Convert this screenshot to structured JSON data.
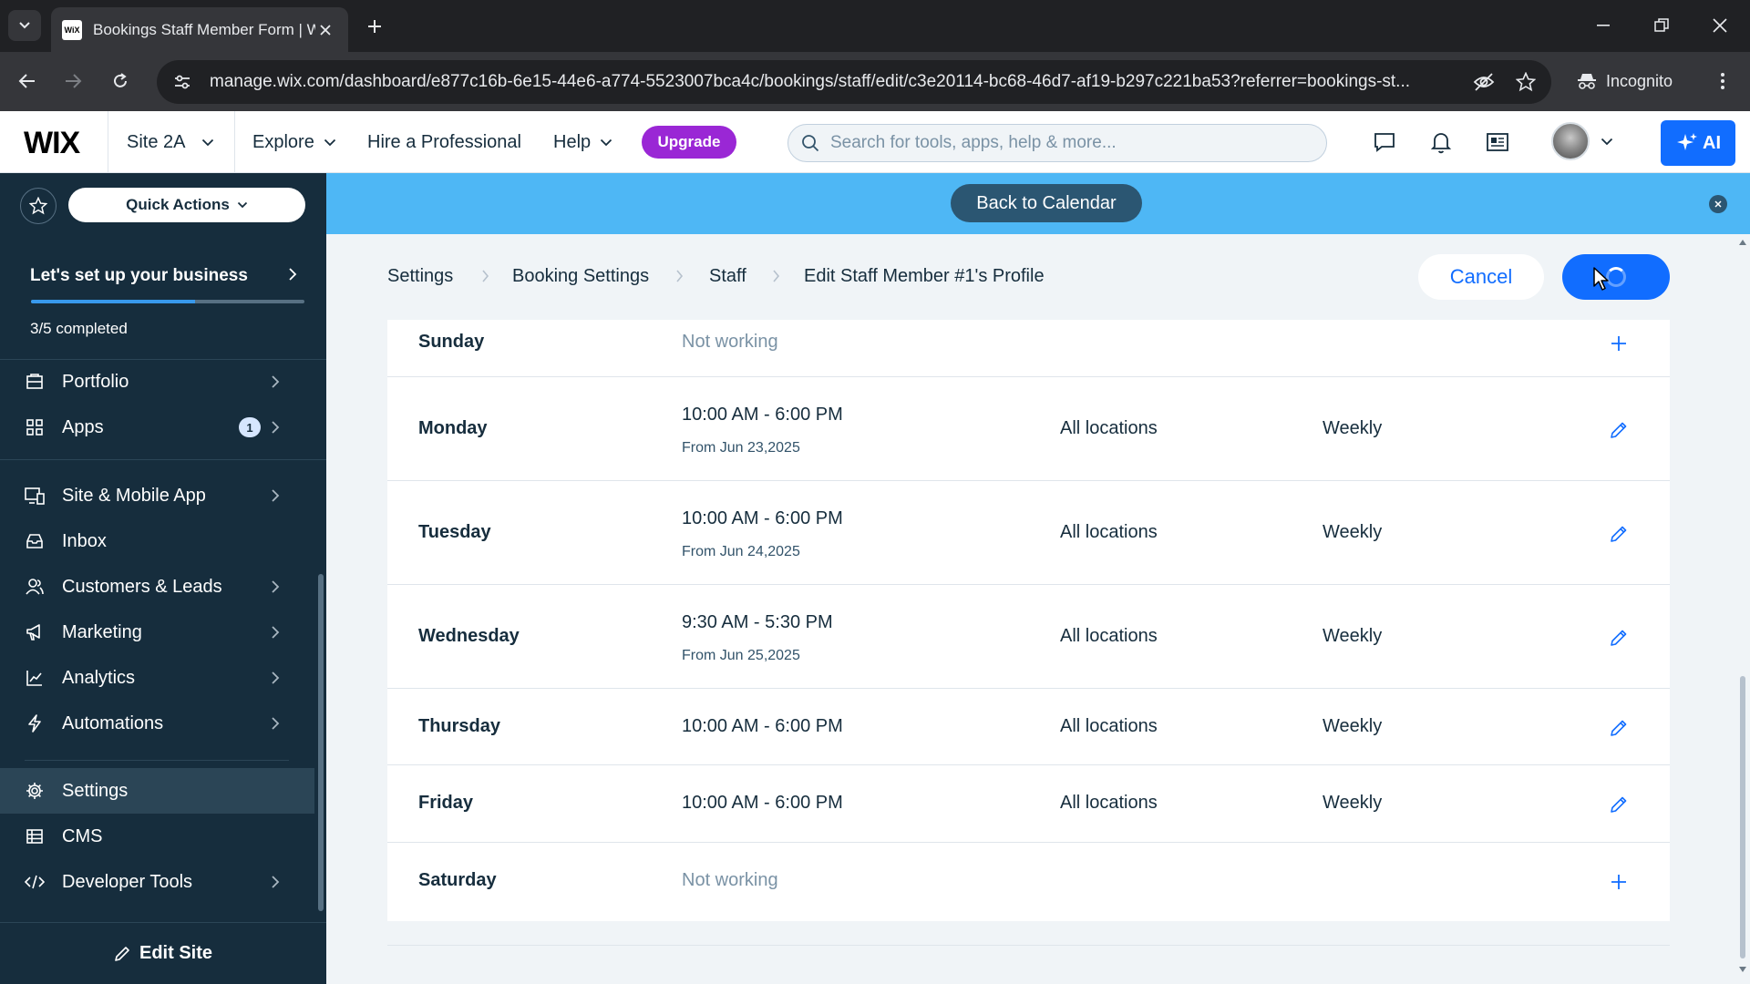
{
  "browser": {
    "tab_title": "Bookings Staff Member Form | Wix",
    "favicon_text": "WiX",
    "url": "manage.wix.com/dashboard/e877c16b-6e15-44e6-a774-5523007bca4c/bookings/staff/edit/c3e20114-bc68-46d7-af19-b297c221ba53?referrer=bookings-st...",
    "incognito_label": "Incognito"
  },
  "topbar": {
    "logo": "WIX",
    "site_name": "Site 2A",
    "explore": "Explore",
    "hire": "Hire a Professional",
    "help": "Help",
    "upgrade": "Upgrade",
    "search_placeholder": "Search for tools, apps, help & more...",
    "ai_label": "AI"
  },
  "sidebar": {
    "quick_actions": "Quick Actions",
    "setup_title": "Let's set up your business",
    "setup_count": "3/5 completed",
    "setup_progress": 0.6,
    "items": [
      {
        "label": "Portfolio",
        "icon": "portfolio-icon"
      },
      {
        "label": "Apps",
        "icon": "apps-icon",
        "badge": "1"
      },
      {
        "label": "Site & Mobile App",
        "icon": "site-mobile-icon"
      },
      {
        "label": "Inbox",
        "icon": "inbox-icon"
      },
      {
        "label": "Customers & Leads",
        "icon": "customers-icon"
      },
      {
        "label": "Marketing",
        "icon": "marketing-icon"
      },
      {
        "label": "Analytics",
        "icon": "analytics-icon"
      },
      {
        "label": "Automations",
        "icon": "automations-icon"
      },
      {
        "label": "Settings",
        "icon": "gear-icon",
        "active": true
      },
      {
        "label": "CMS",
        "icon": "cms-icon"
      },
      {
        "label": "Developer Tools",
        "icon": "code-icon"
      }
    ],
    "edit_site": "Edit Site"
  },
  "banner": {
    "back_to_calendar": "Back to Calendar"
  },
  "breadcrumb": [
    "Settings",
    "Booking Settings",
    "Staff",
    "Edit Staff Member #1's Profile"
  ],
  "actions": {
    "cancel": "Cancel"
  },
  "schedule": [
    {
      "day": "Sunday",
      "status": "Not working",
      "action": "add"
    },
    {
      "day": "Monday",
      "time": "10:00 AM - 6:00 PM",
      "from": "From Jun 23,2025",
      "location": "All locations",
      "repeat": "Weekly",
      "action": "edit"
    },
    {
      "day": "Tuesday",
      "time": "10:00 AM - 6:00 PM",
      "from": "From Jun 24,2025",
      "location": "All locations",
      "repeat": "Weekly",
      "action": "edit"
    },
    {
      "day": "Wednesday",
      "time": "9:30 AM - 5:30 PM",
      "from": "From Jun 25,2025",
      "location": "All locations",
      "repeat": "Weekly",
      "action": "edit"
    },
    {
      "day": "Thursday",
      "time": "10:00 AM - 6:00 PM",
      "location": "All locations",
      "repeat": "Weekly",
      "action": "edit"
    },
    {
      "day": "Friday",
      "time": "10:00 AM - 6:00 PM",
      "location": "All locations",
      "repeat": "Weekly",
      "action": "edit"
    },
    {
      "day": "Saturday",
      "status": "Not working",
      "action": "add"
    }
  ],
  "colors": {
    "sidebar_bg": "#162d3d",
    "banner_bg": "#4eb7f5",
    "primary": "#116dff",
    "upgrade": "#9a27d5"
  }
}
